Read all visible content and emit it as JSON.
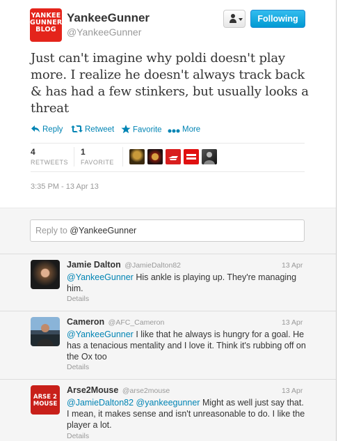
{
  "tweet": {
    "avatar_lines": [
      "YANKEE",
      "GUNNER",
      "BLOG"
    ],
    "fullname": "YankeeGunner",
    "screen_name": "@YankeeGunner",
    "follow_label": "Following",
    "text": "Just can't imagine why poldi doesn't play more. I realize he doesn't always track back & has had a few stinkers, but usually looks a threat",
    "actions": {
      "reply": "Reply",
      "retweet": "Retweet",
      "favorite": "Favorite",
      "more": "More"
    },
    "stats": {
      "retweets_count": "4",
      "retweets_label": "RETWEETS",
      "favorites_count": "1",
      "favorites_label": "FAVORITE"
    },
    "timestamp": "3:35 PM - 13 Apr 13"
  },
  "reply_box": {
    "prefix": "Reply to ",
    "handle": "@YankeeGunner"
  },
  "replies": [
    {
      "name": "Jamie Dalton",
      "screen_name": "@JamieDalton82",
      "date": "13 Apr",
      "mention": "@YankeeGunner",
      "text": " His ankle is playing up. They're managing him.",
      "details": "Details"
    },
    {
      "name": "Cameron",
      "screen_name": "@AFC_Cameron",
      "date": "13 Apr",
      "mention": "@YankeeGunner",
      "text": " I like that he always is hungry for a goal. He has a tenacious mentality and I love it. Think it's rubbing off on the Ox too",
      "details": "Details"
    },
    {
      "name": "Arse2Mouse",
      "screen_name": "@arse2mouse",
      "date": "13 Apr",
      "mention": "@JamieDalton82 @yankeegunner",
      "text": " Might as well just say that. I mean, it makes sense and isn't unreasonable to do. I like the player a lot.",
      "details": "Details",
      "avatar_lines": [
        "ARSE 2",
        "MOUSE"
      ]
    }
  ],
  "colors": {
    "link": "#0084b4",
    "follow_button": "#019ad2",
    "avatar_red": "#e4241b"
  }
}
